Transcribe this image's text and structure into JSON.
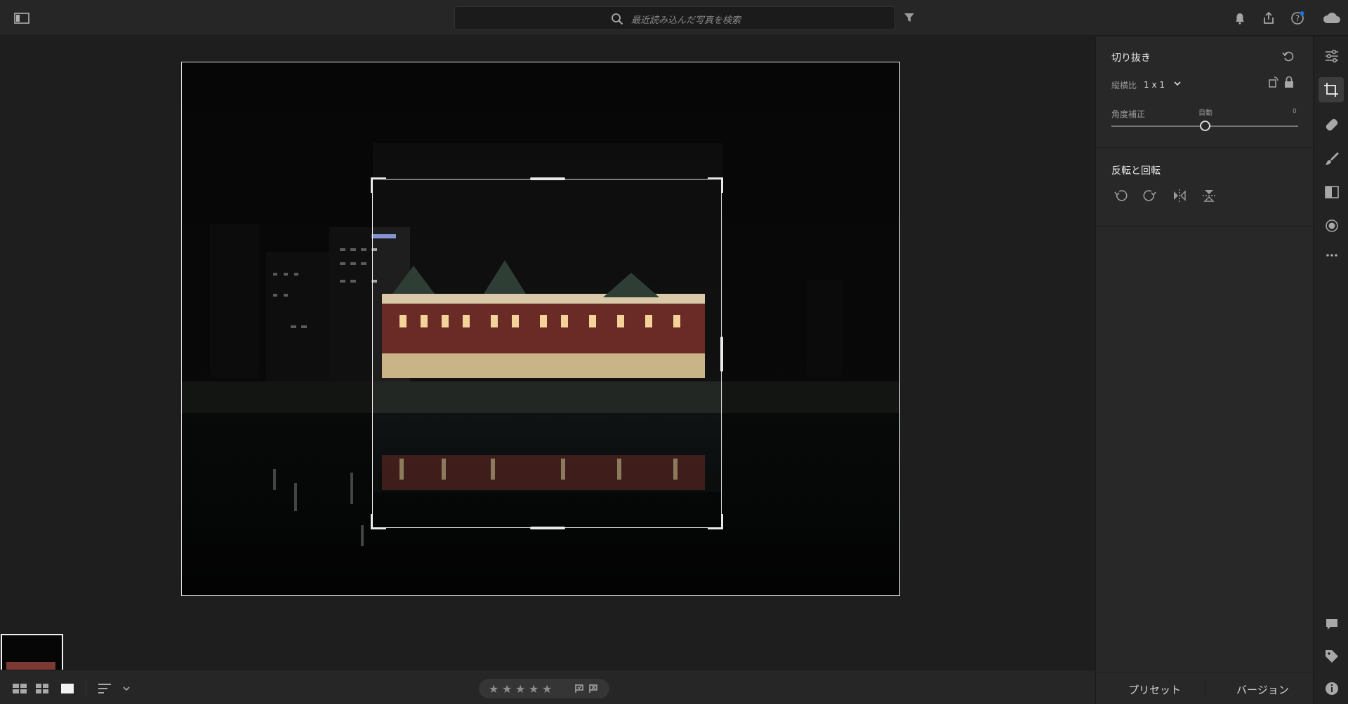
{
  "search": {
    "placeholder": "最近読み込んだ写真を検索"
  },
  "crop_panel": {
    "title": "切り抜き",
    "aspect_label": "縦横比",
    "aspect_value": "1 x 1",
    "straighten_label": "角度補正",
    "straighten_auto": "自動",
    "straighten_value": "0",
    "straighten_fraction": 0.5
  },
  "rotate_panel": {
    "title": "反転と回転"
  },
  "bottom_tabs": {
    "presets": "プリセット",
    "versions": "バージョン"
  },
  "rating": {
    "stars": 0,
    "max": 5
  },
  "colors": {
    "accent": "#1473e6",
    "panel": "#282828",
    "bg": "#1e1e1e"
  }
}
